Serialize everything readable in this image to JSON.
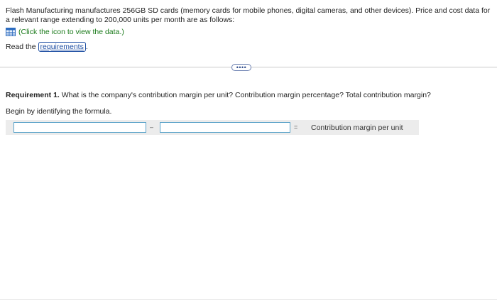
{
  "intro": {
    "text": "Flash Manufacturing manufactures 256GB SD cards (memory cards for mobile phones, digital cameras, and other devices). Price and cost data for a relevant range extending to 200,000 units per month are as follows:"
  },
  "data_link": {
    "label": "(Click the icon to view the data.)",
    "icon": "table-icon"
  },
  "read_line": {
    "prefix": "Read the ",
    "link_label": "requirements",
    "suffix": "."
  },
  "divider": {
    "expand_label": "••••"
  },
  "requirement": {
    "bold": "Requirement 1.",
    "text": " What is the company's contribution margin per unit? Contribution margin percentage? Total contribution margin?"
  },
  "instruction": "Begin by identifying the formula.",
  "formula": {
    "input1_value": "",
    "operator": "–",
    "input2_value": "",
    "equals": "=",
    "result_label": "Contribution margin per unit"
  },
  "colors": {
    "link_green": "#1a7a1a",
    "link_blue": "#1f4fa3",
    "input_border": "#5ba3c9",
    "row_background": "#ececec"
  }
}
